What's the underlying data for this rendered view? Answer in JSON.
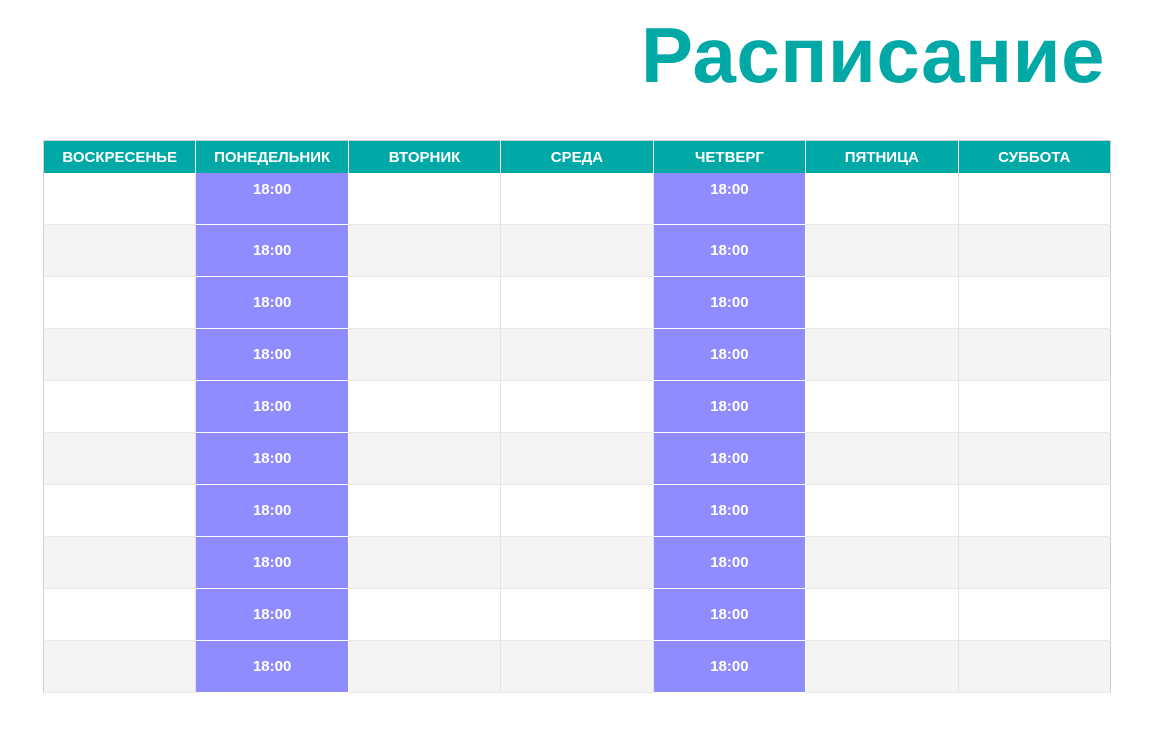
{
  "title": "Расписание",
  "days": [
    "ВОСКРЕСЕНЬЕ",
    "ПОНЕДЕЛЬНИК",
    "ВТОРНИК",
    "СРЕДА",
    "ЧЕТВЕРГ",
    "ПЯТНИЦА",
    "СУББОТА"
  ],
  "colors": {
    "accent": "#00a9a5",
    "slot": "#8e8cff",
    "row_alt": "#f4f4f4"
  },
  "rows": [
    [
      "",
      "18:00",
      "",
      "",
      "18:00",
      "",
      ""
    ],
    [
      "",
      "18:00",
      "",
      "",
      "18:00",
      "",
      ""
    ],
    [
      "",
      "18:00",
      "",
      "",
      "18:00",
      "",
      ""
    ],
    [
      "",
      "18:00",
      "",
      "",
      "18:00",
      "",
      ""
    ],
    [
      "",
      "18:00",
      "",
      "",
      "18:00",
      "",
      ""
    ],
    [
      "",
      "18:00",
      "",
      "",
      "18:00",
      "",
      ""
    ],
    [
      "",
      "18:00",
      "",
      "",
      "18:00",
      "",
      ""
    ],
    [
      "",
      "18:00",
      "",
      "",
      "18:00",
      "",
      ""
    ],
    [
      "",
      "18:00",
      "",
      "",
      "18:00",
      "",
      ""
    ],
    [
      "",
      "18:00",
      "",
      "",
      "18:00",
      "",
      ""
    ]
  ]
}
